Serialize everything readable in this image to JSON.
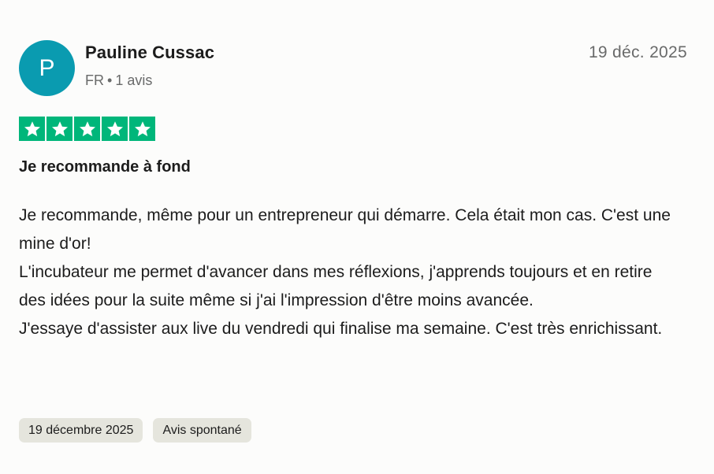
{
  "review": {
    "author": {
      "initial": "P",
      "name": "Pauline Cussac",
      "country": "FR",
      "separator": "•",
      "review_count": "1 avis",
      "avatar_color": "#0a9bb0"
    },
    "date_short": "19 déc. 2025",
    "rating": {
      "stars": 5,
      "max_stars": 5,
      "color": "#00b67a"
    },
    "title": "Je recommande à fond",
    "body_paragraphs": [
      "Je recommande, même pour un entrepreneur qui démarre. Cela était mon cas. C'est une mine d'or!",
      "L'incubateur me permet d'avancer dans mes réflexions, j'apprends toujours et en retire des idées pour la suite même si j'ai l'impression d'être moins avancée.",
      "J'essaye d'assister aux live du vendredi qui finalise ma semaine. C'est très enrichissant."
    ],
    "tags": [
      "19 décembre 2025",
      "Avis spontané"
    ]
  }
}
